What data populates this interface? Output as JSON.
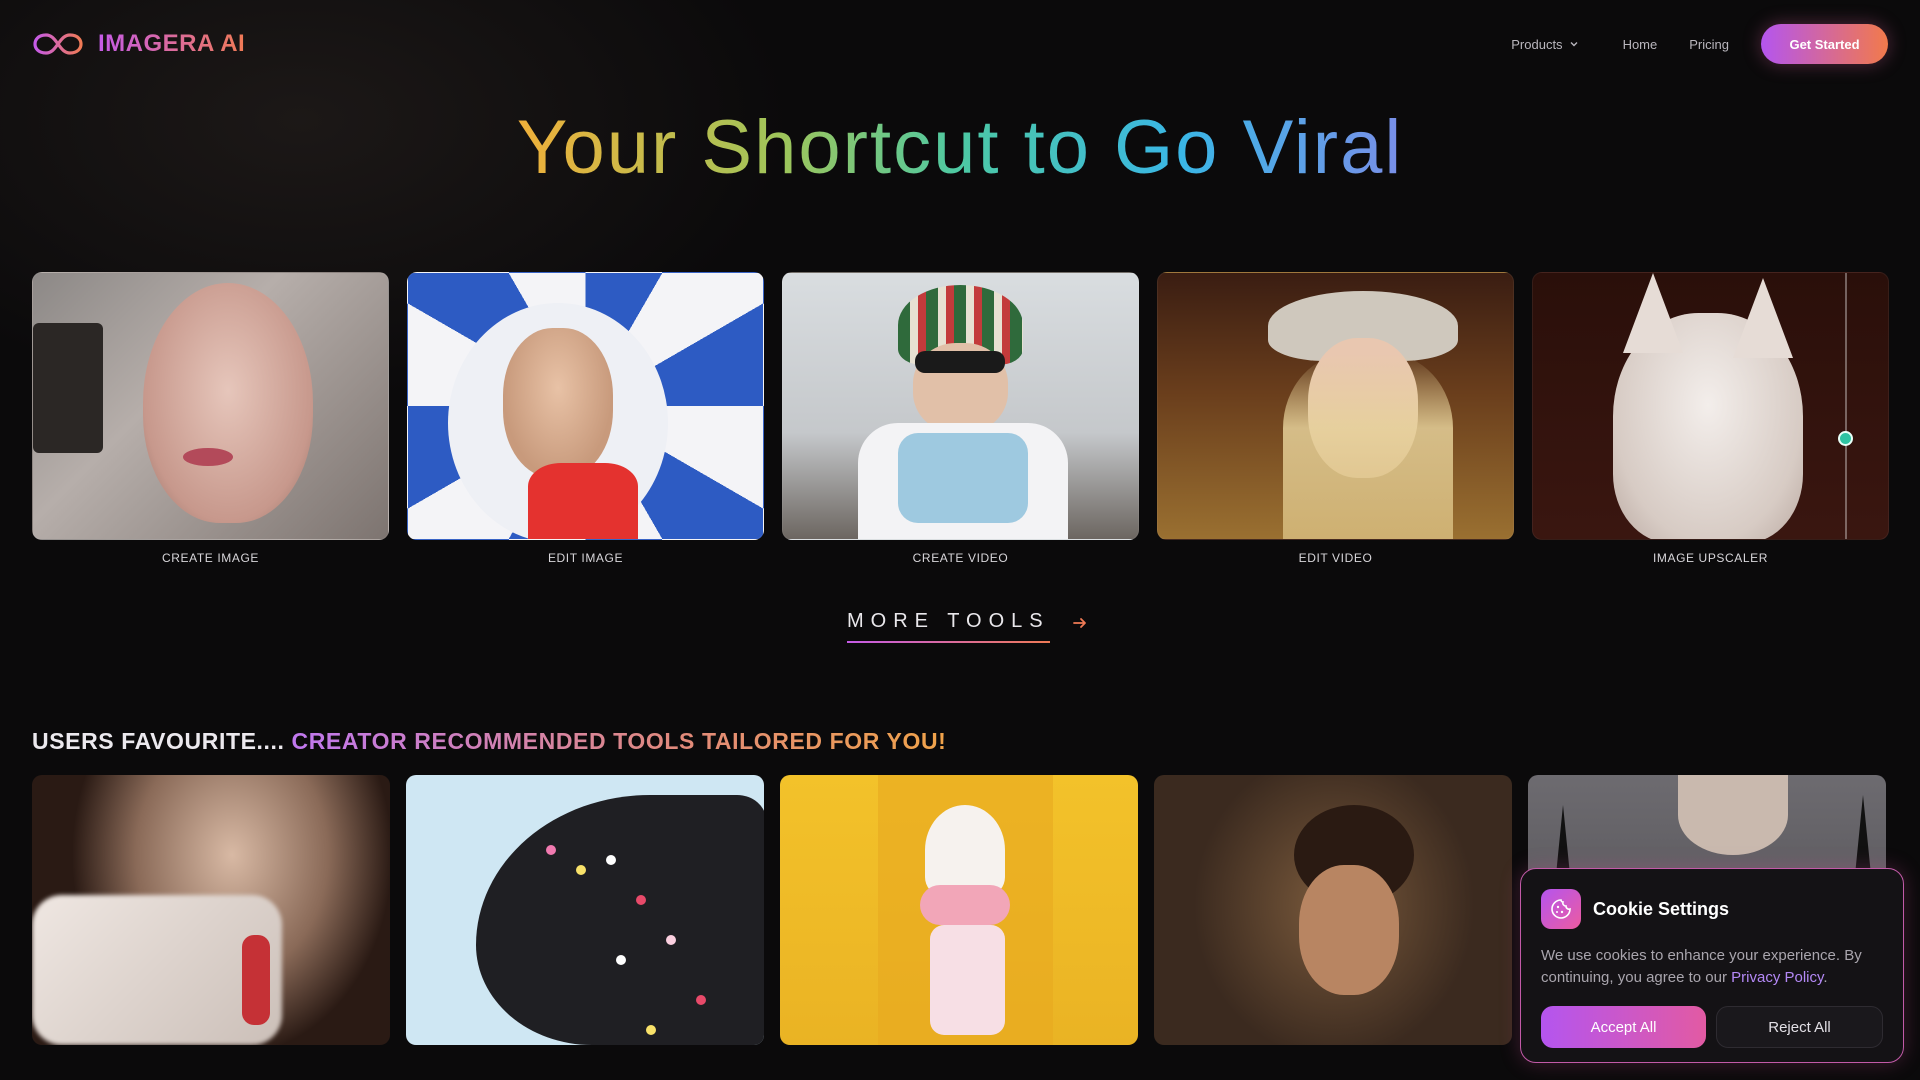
{
  "brand": {
    "name": "IMAGERA AI"
  },
  "nav": {
    "products": "Products",
    "home": "Home",
    "pricing": "Pricing",
    "cta": "Get Started"
  },
  "hero": {
    "title": "Your Shortcut to Go Viral"
  },
  "tools": [
    {
      "label": "CREATE IMAGE"
    },
    {
      "label": "EDIT IMAGE"
    },
    {
      "label": "CREATE VIDEO"
    },
    {
      "label": "EDIT VIDEO"
    },
    {
      "label": "IMAGE UPSCALER"
    }
  ],
  "more_tools": {
    "label": "MORE TOOLS"
  },
  "favourites": {
    "heading_plain": "USERS FAVOURITE....",
    "heading_accent": "CREATOR RECOMMENDED TOOLS TAILORED FOR YOU!"
  },
  "cookie": {
    "title": "Cookie Settings",
    "body": "We use cookies to enhance your experience. By continuing, you agree to our",
    "link": "Privacy Policy",
    "link_suffix": ".",
    "accept": "Accept All",
    "reject": "Reject All"
  },
  "colors": {
    "accent_start": "#b455ef",
    "accent_end": "#f27a4b",
    "background": "#0b0a0b"
  }
}
